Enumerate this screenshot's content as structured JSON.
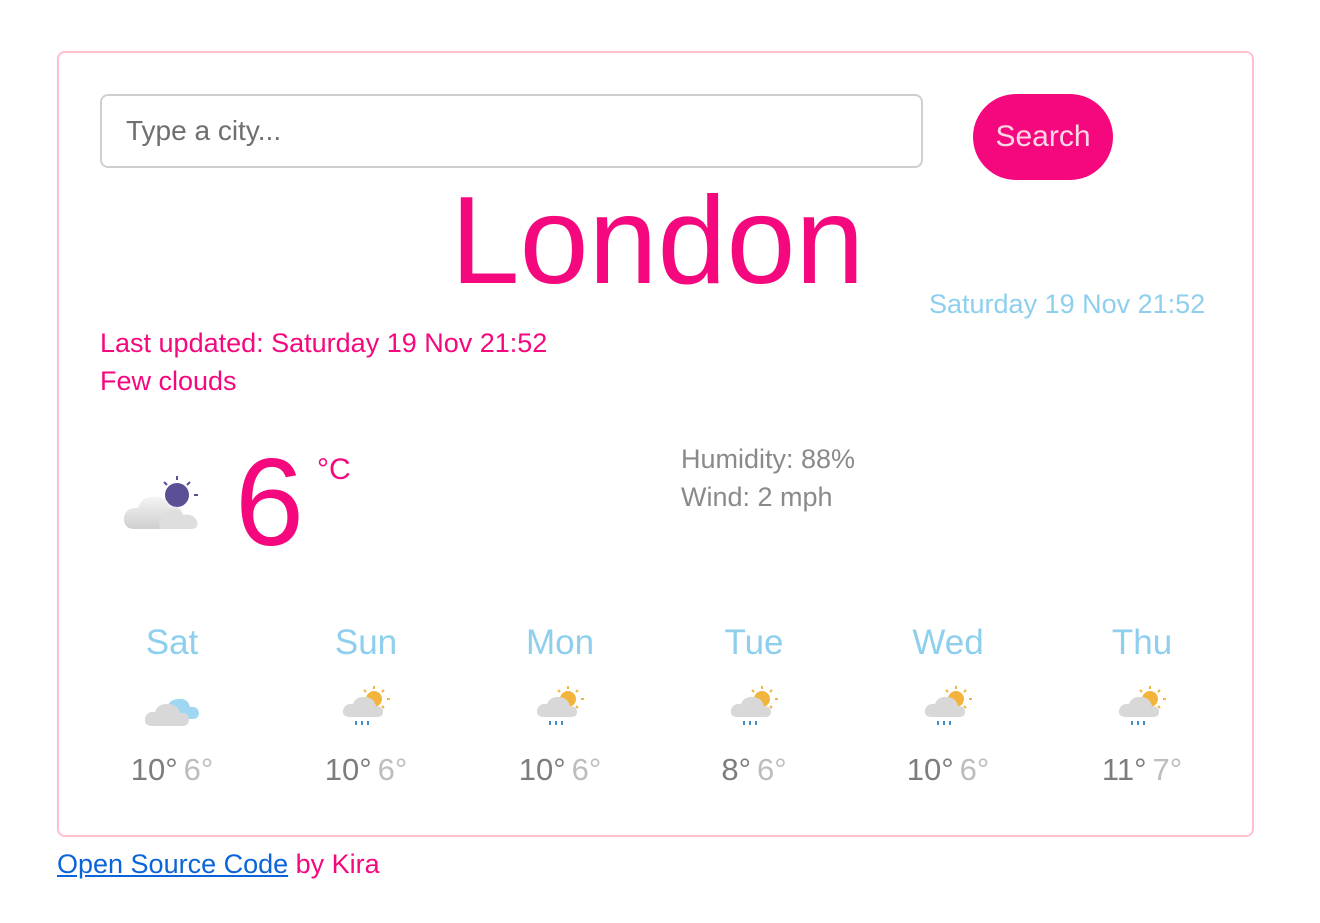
{
  "search": {
    "placeholder": "Type a city...",
    "button_label": "Search"
  },
  "current": {
    "city": "London",
    "date_time": "Saturday 19 Nov 21:52",
    "last_updated": "Last updated: Saturday 19 Nov 21:52",
    "description": "Few clouds",
    "temperature": "6",
    "unit": "°C",
    "humidity": "Humidity: 88%",
    "wind": "Wind: 2 mph",
    "icon": "few-clouds-night-icon"
  },
  "forecast": [
    {
      "day": "Sat",
      "max": "10°",
      "min": "6°",
      "icon": "cloudy-icon"
    },
    {
      "day": "Sun",
      "max": "10°",
      "min": "6°",
      "icon": "sun-cloud-rain-icon"
    },
    {
      "day": "Mon",
      "max": "10°",
      "min": "6°",
      "icon": "sun-cloud-rain-icon"
    },
    {
      "day": "Tue",
      "max": "8°",
      "min": "6°",
      "icon": "sun-cloud-rain-icon"
    },
    {
      "day": "Wed",
      "max": "10°",
      "min": "6°",
      "icon": "sun-cloud-rain-icon"
    },
    {
      "day": "Thu",
      "max": "11°",
      "min": "7°",
      "icon": "sun-cloud-rain-icon"
    }
  ],
  "footer": {
    "link_text": "Open Source Code",
    "suffix": " by Kira"
  },
  "colors": {
    "accent": "#f5087e",
    "light_blue": "#8ecfee",
    "border": "#ffc0cb",
    "link": "#0b64d8"
  }
}
